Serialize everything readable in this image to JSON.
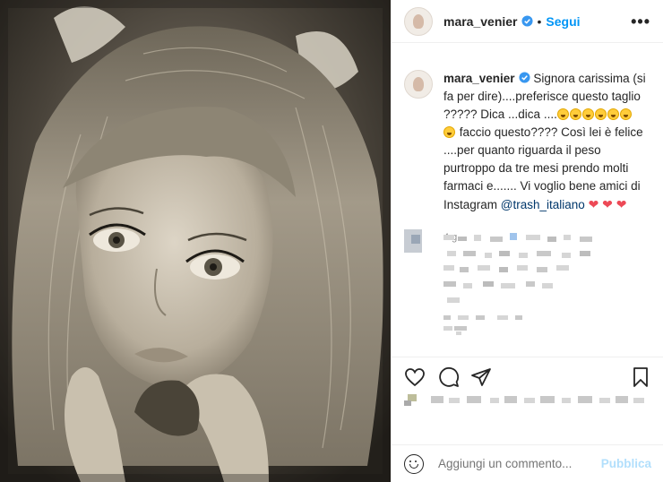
{
  "post": {
    "username": "mara_venier",
    "follow_label": "Segui",
    "dot": "•",
    "more_label": "•••"
  },
  "caption": {
    "username": "mara_venier",
    "text_part1": "Signora carissima (si fa per dire)....preferisce questo taglio ????? Dica ...dica ....",
    "text_part2": "faccio questo???? Così lei è felice ....per quanto riguarda il peso purtroppo da tre mesi prendo molti farmaci e....... Vi voglio bene amici di Instagram ",
    "mention": "@trash_italiano",
    "hearts": "❤ ❤ ❤",
    "age": "4 g"
  },
  "comment_box": {
    "placeholder": "Aggiungi un commento...",
    "publish_label": "Pubblica"
  },
  "icons": {
    "like": "heart-outline-icon",
    "comment": "speech-bubble-icon",
    "share": "paper-plane-icon",
    "save": "bookmark-icon",
    "emoji": "smiley-icon",
    "verified": "verified-badge-icon"
  },
  "colors": {
    "accent": "#0095f6",
    "heart": "#ed4956",
    "publish_disabled": "#b2dffc",
    "verified": "#3897f0"
  }
}
